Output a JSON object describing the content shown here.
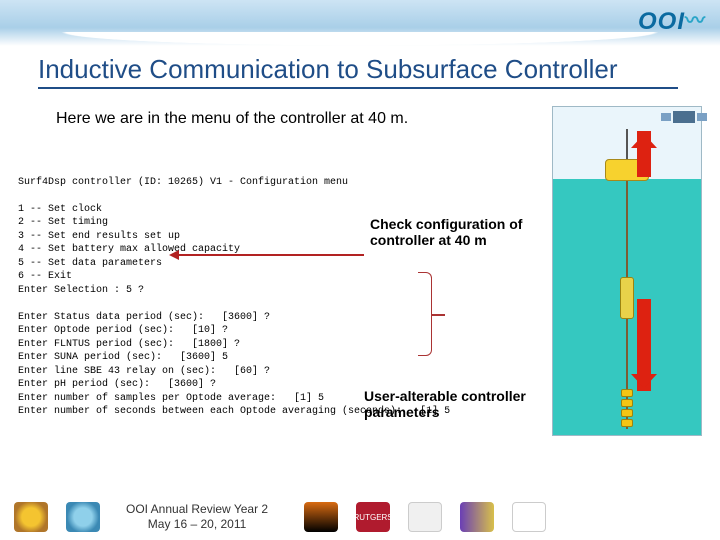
{
  "brand": "OOI",
  "title": "Inductive Communication to Subsurface Controller",
  "intro": "Here we are in the menu of the controller at 40 m.",
  "terminal": {
    "header": "Surf4Dsp controller (ID: 10265) V1 - Configuration menu",
    "menu": [
      "1 -- Set clock",
      "2 -- Set timing",
      "3 -- Set end results set up",
      "4 -- Set battery max allowed capacity",
      "5 -- Set data parameters",
      "6 -- Exit"
    ],
    "prompt": "Enter Selection : 5 ?",
    "params": [
      "Enter Status data period (sec):   [3600] ?",
      "Enter Optode period (sec):   [10] ?",
      "Enter FLNTUS period (sec):   [1800] ?",
      "Enter SUNA period (sec):   [3600] 5",
      "Enter line SBE 43 relay on (sec):   [60] ?",
      "Enter pH period (sec):   [3600] ?",
      "Enter number of samples per Optode average:   [1] 5",
      "Enter number of seconds between each Optode averaging (seconds):   [1] 5"
    ]
  },
  "callouts": {
    "config": "Check configuration of controller at 40 m",
    "useralter": "User-alterable controller parameters"
  },
  "footer": {
    "line1": "OOI Annual Review Year 2",
    "line2": "May 16 – 20, 2011",
    "rutgers": "RUTGERS"
  }
}
